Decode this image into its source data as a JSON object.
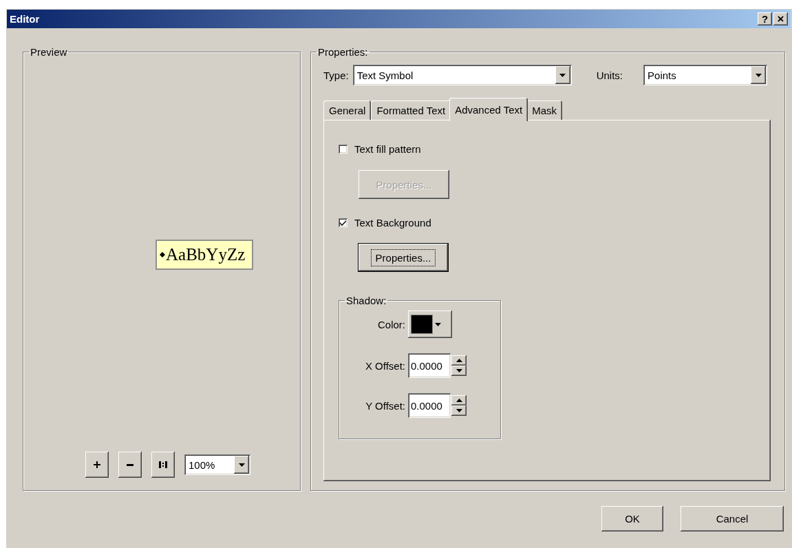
{
  "window": {
    "title": "Editor",
    "controls": [
      {
        "kind": "help",
        "label": "?"
      },
      {
        "kind": "close",
        "label": "×"
      }
    ]
  },
  "preview": {
    "title": "Preview",
    "sample": "AaBbYyZz",
    "zoom": "100%"
  },
  "properties": {
    "title": "Properties:",
    "type": {
      "label": "Type:",
      "value": "Text Symbol"
    },
    "units": {
      "label": "Units:",
      "value": "Points"
    },
    "tabs": [
      {
        "label": "General",
        "selected": false
      },
      {
        "label": "Formatted Text",
        "selected": false
      },
      {
        "label": "Advanced Text",
        "selected": true
      },
      {
        "label": "Mask",
        "selected": false
      }
    ],
    "options": [
      {
        "label": "Text fill pattern",
        "checked": false,
        "button": {
          "label": "Properties...",
          "disabled": true,
          "focused": false
        }
      },
      {
        "label": "Text Background",
        "checked": true,
        "button": {
          "label": "Properties...",
          "disabled": false,
          "focused": true
        }
      }
    ],
    "shadow": {
      "title": "Shadow:",
      "color": {
        "label": "Color:",
        "color": "#000000"
      },
      "offsets": [
        {
          "label": "X Offset:",
          "value": "0.0000"
        },
        {
          "label": "Y Offset:",
          "value": "0.0000"
        }
      ]
    }
  },
  "footer": {
    "buttons": [
      {
        "label": "OK"
      },
      {
        "label": "Cancel"
      }
    ]
  }
}
